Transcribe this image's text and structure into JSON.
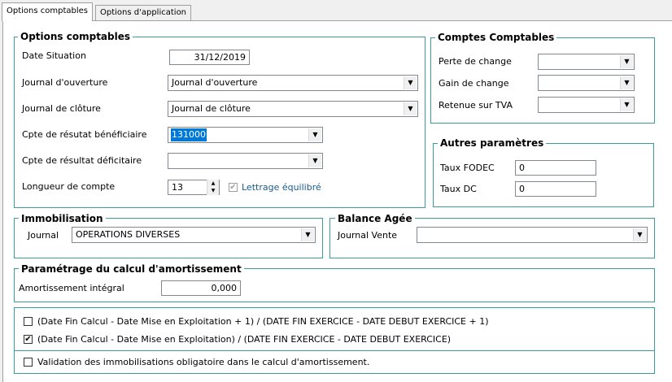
{
  "tabs": [
    {
      "label": "Options comptables"
    },
    {
      "label": "Options d'application"
    }
  ],
  "options": {
    "title": "Options comptables",
    "date_situation_label": "Date Situation",
    "date_situation_value": "31/12/2019",
    "journal_ouverture_label": "Journal d'ouverture",
    "journal_ouverture_value": "Journal d'ouverture",
    "journal_cloture_label": "Journal de clôture",
    "journal_cloture_value": "Journal de clôture",
    "cpte_benef_label": "Cpte de résutat bénéficiaire",
    "cpte_benef_value": "131000",
    "cpte_deficit_label": "Cpte de résultat déficitaire",
    "cpte_deficit_value": "",
    "longueur_label": "Longueur de compte",
    "longueur_value": "13",
    "lettrage_label": "Lettrage équilibré"
  },
  "comptes": {
    "title": "Comptes Comptables",
    "perte_label": "Perte de change",
    "gain_label": "Gain de change",
    "retenue_label": "Retenue sur TVA"
  },
  "autres": {
    "title": "Autres paramètres",
    "fodec_label": "Taux FODEC",
    "fodec_value": "0",
    "dc_label": "Taux DC",
    "dc_value": "0"
  },
  "immobilisation": {
    "title": "Immobilisation",
    "journal_label": "Journal",
    "journal_value": "OPERATIONS DIVERSES"
  },
  "balance": {
    "title": "Balance Agée",
    "journal_vente_label": "Journal Vente",
    "journal_vente_value": ""
  },
  "amortissement": {
    "title": "Paramétrage du calcul d'amortissement",
    "integral_label": "Amortissement intégral",
    "integral_value": "0,000"
  },
  "formulas": {
    "formula1": "(Date Fin Calcul - Date Mise en Exploitation + 1) / (DATE FIN EXERCICE - DATE DEBUT EXERCICE + 1)",
    "formula1_checked": false,
    "formula2": "(Date Fin Calcul - Date Mise en Exploitation) / (DATE FIN EXERCICE - DATE DEBUT EXERCICE)",
    "formula2_checked": true
  },
  "validation": {
    "label": "Validation des immobilisations obligatoire dans le calcul d'amortissement.",
    "checked": false
  },
  "colors": {
    "group_border": "#3c9b9b",
    "selection": "#0078d7"
  }
}
